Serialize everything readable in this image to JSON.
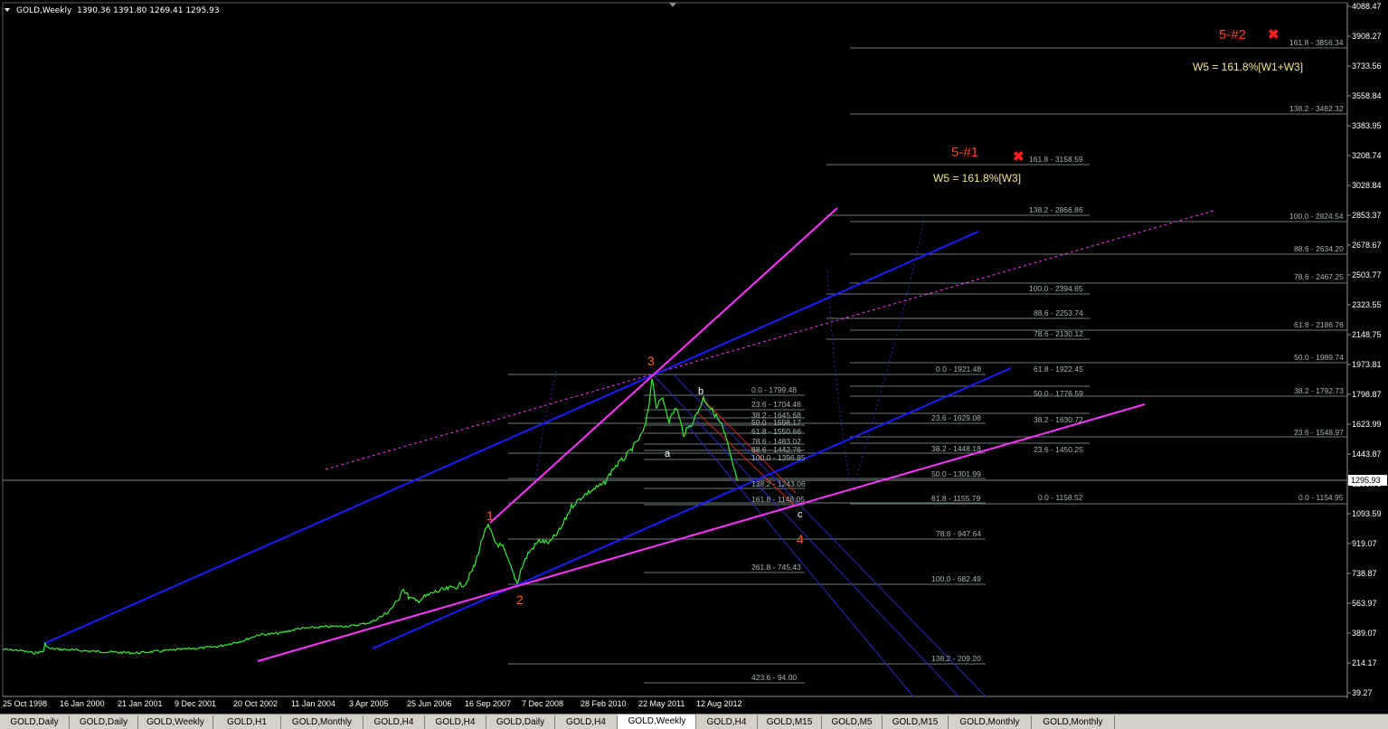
{
  "chart": {
    "symbol_label": "GOLD,Weekly",
    "ohlc": "1390.36 1391.80 1269.41 1295.93",
    "current_price": "1295.93"
  },
  "price_axis": [
    "4088.47",
    "3908.27",
    "3733.56",
    "3558.84",
    "3383.95",
    "3208.74",
    "3028.84",
    "2853.37",
    "2678.67",
    "2503.77",
    "2323.55",
    "2148.75",
    "1973.81",
    "1798.87",
    "1623.99",
    "1443.87",
    "1268.76",
    "1093.59",
    "919.07",
    "738.87",
    "563.97",
    "389.07",
    "214.17",
    "39.27"
  ],
  "time_axis": [
    "25 Oct 1998",
    "16 Jan 2000",
    "21 Jan 2001",
    "9 Dec 2001",
    "20 Oct 2002",
    "11 Jan 2004",
    "3 Apr 2005",
    "25 Jun 2006",
    "16 Sep 2007",
    "7 Dec 2008",
    "28 Feb 2010",
    "22 May 2011",
    "12 Aug 2012"
  ],
  "fib_labels": {
    "set1": [
      "0.0 - 1799.48",
      "23.6 - 1704.46",
      "38.2 - 1645.68",
      "50.0 - 1598.17",
      "61.8 - 1550.66",
      "78.6 - 1483.02",
      "88.6 - 1442.76",
      "100.0 - 1396.85",
      "138.2 - 1243.06",
      "161.8 - 1148.05",
      "261.8 - 745.43",
      "423.6 - 94.00"
    ],
    "set2": [
      "161.8 - 3158.59",
      "138.2 - 2866.86",
      "100.0 - 2394.65",
      "88.6 - 2253.74",
      "78.6 - 2130.12",
      "0.0 - 1921.48",
      "23.6 - 1629.08",
      "38.2 - 1448.18",
      "50.0 - 1301.99",
      "61.8 - 1155.79",
      "78.6 - 947.64",
      "100.0 - 682.49",
      "138.2 - 209.20"
    ],
    "set3": [
      "61.8 - 1922.45",
      "50.0 - 1776.59",
      "38.2 - 1630.72",
      "23.6 - 1450.25",
      "0.0 - 1158.52"
    ],
    "set4": [
      "161.8 - 3856.34",
      "138.2 - 3462.32",
      "100.0 - 2824.54",
      "88.6 - 2634.20",
      "78.6 - 2467.25",
      "61.8 - 2186.76",
      "50.0 - 1989.74",
      "38.2 - 1792.73",
      "23.6 - 1548.97",
      "0.0 - 1154.95"
    ]
  },
  "wave_labels": {
    "w1": "1",
    "w2": "2",
    "w3": "3",
    "w4": "4",
    "wa": "a",
    "wb": "b",
    "wc": "c"
  },
  "targets": {
    "t1_label": "5-#1",
    "t1_text": "W5 = 161.8%[W3]",
    "t2_label": "5-#2",
    "t2_text": "W5 = 161.8%[W1+W3]",
    "marker": "✖"
  },
  "tabs": [
    "GOLD,Daily",
    "GOLD,Daily",
    "GOLD,Weekly",
    "GOLD,H1",
    "GOLD,Monthly",
    "GOLD,H4",
    "GOLD,H4",
    "GOLD,Daily",
    "GOLD,H4",
    "GOLD,Weekly",
    "GOLD,H4",
    "GOLD,M15",
    "GOLD,M5",
    "GOLD,M15",
    "GOLD,Monthly",
    "GOLD,Monthly"
  ],
  "active_tab": 9,
  "colors": {
    "price_line": "#33ee33",
    "wave_label": "#ff5a1e",
    "target_label": "#ff3b1e",
    "magenta": "#ff33ff",
    "blue": "#1a1aff",
    "fib_line": "#6a7a7a",
    "fib_text": "#a8b4b4"
  }
}
